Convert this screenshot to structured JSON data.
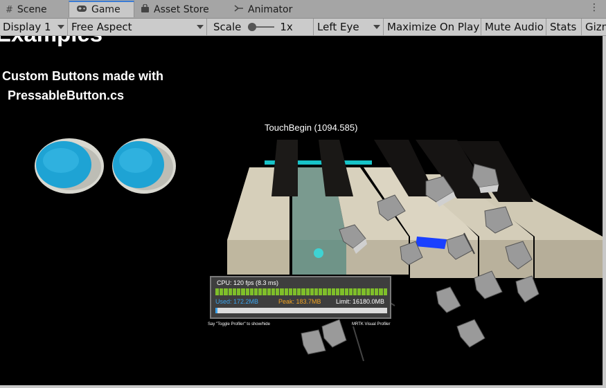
{
  "tabs": [
    {
      "label": "Scene",
      "icon": "grid-icon"
    },
    {
      "label": "Game",
      "icon": "gamepad-icon",
      "active": true
    },
    {
      "label": "Asset Store",
      "icon": "bag-icon"
    },
    {
      "label": "Animator",
      "icon": "animator-icon"
    }
  ],
  "toolbar": {
    "display": "Display 1",
    "aspect": "Free Aspect",
    "scale_label": "Scale",
    "scale_value": "1x",
    "eye": "Left Eye",
    "maximize": "Maximize On Play",
    "mute": "Mute Audio",
    "stats": "Stats",
    "gizmos": "Gizmos"
  },
  "game": {
    "heading": "Examples",
    "subtitle_line1": "Custom Buttons made with",
    "subtitle_line2": "PressableButton.cs",
    "touch_label": "TouchBegin (1094.585)"
  },
  "profiler": {
    "cpu": "CPU: 120 fps (8.3 ms)",
    "used": "Used: 172.2MB",
    "peak": "Peak: 183.7MB",
    "limit": "Limit: 16180.0MB",
    "hint": "Say \"Toggle Profiler\" to show/hide",
    "brand": "MRTK Visual Profiler"
  },
  "colors": {
    "accent": "#3a7bd5",
    "button_blue": "#1ea3d4",
    "cpu_bar": "#7fbf2a",
    "used": "#3ba5f0",
    "peak": "#f5a623"
  }
}
